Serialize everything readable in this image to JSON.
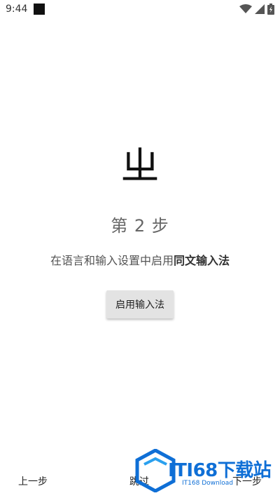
{
  "status": {
    "time": "9:44"
  },
  "main": {
    "logo_char": "ㄓ",
    "step_title": "第 2 步",
    "description_prefix": "在语言和输入设置中启用",
    "description_emphasis": "同文输入法",
    "enable_button": "启用输入法"
  },
  "nav": {
    "prev": "上一步",
    "skip": "跳过",
    "next": "下一步"
  },
  "watermark": {
    "text": "ITI68下载站",
    "subtext": "IT168 Download"
  }
}
